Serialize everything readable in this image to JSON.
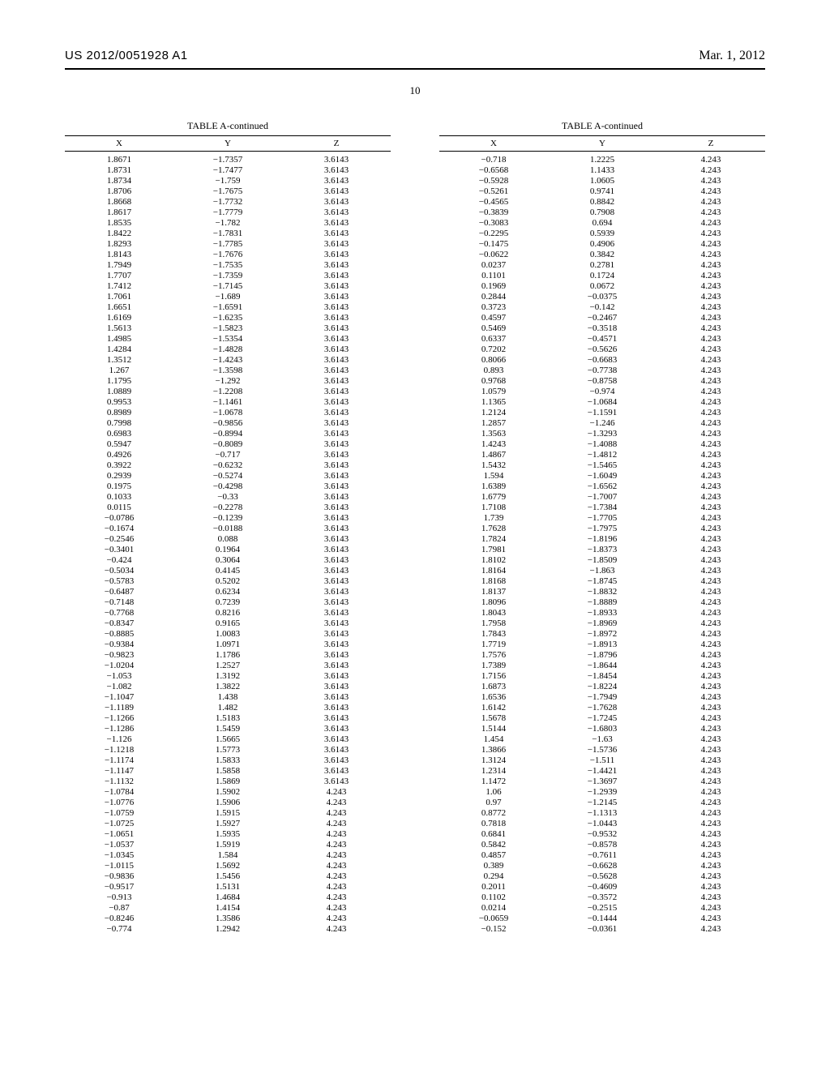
{
  "header": {
    "pub_number": "US 2012/0051928 A1",
    "date": "Mar. 1, 2012",
    "page_label": "10"
  },
  "table_title": "TABLE A-continued",
  "columns": [
    "X",
    "Y",
    "Z"
  ],
  "chart_data": {
    "type": "table",
    "left": [
      [
        "1.8671",
        "−1.7357",
        "3.6143"
      ],
      [
        "1.8731",
        "−1.7477",
        "3.6143"
      ],
      [
        "1.8734",
        "−1.759",
        "3.6143"
      ],
      [
        "1.8706",
        "−1.7675",
        "3.6143"
      ],
      [
        "1.8668",
        "−1.7732",
        "3.6143"
      ],
      [
        "1.8617",
        "−1.7779",
        "3.6143"
      ],
      [
        "1.8535",
        "−1.782",
        "3.6143"
      ],
      [
        "1.8422",
        "−1.7831",
        "3.6143"
      ],
      [
        "1.8293",
        "−1.7785",
        "3.6143"
      ],
      [
        "1.8143",
        "−1.7676",
        "3.6143"
      ],
      [
        "1.7949",
        "−1.7535",
        "3.6143"
      ],
      [
        "1.7707",
        "−1.7359",
        "3.6143"
      ],
      [
        "1.7412",
        "−1.7145",
        "3.6143"
      ],
      [
        "1.7061",
        "−1.689",
        "3.6143"
      ],
      [
        "1.6651",
        "−1.6591",
        "3.6143"
      ],
      [
        "1.6169",
        "−1.6235",
        "3.6143"
      ],
      [
        "1.5613",
        "−1.5823",
        "3.6143"
      ],
      [
        "1.4985",
        "−1.5354",
        "3.6143"
      ],
      [
        "1.4284",
        "−1.4828",
        "3.6143"
      ],
      [
        "1.3512",
        "−1.4243",
        "3.6143"
      ],
      [
        "1.267",
        "−1.3598",
        "3.6143"
      ],
      [
        "1.1795",
        "−1.292",
        "3.6143"
      ],
      [
        "1.0889",
        "−1.2208",
        "3.6143"
      ],
      [
        "0.9953",
        "−1.1461",
        "3.6143"
      ],
      [
        "0.8989",
        "−1.0678",
        "3.6143"
      ],
      [
        "0.7998",
        "−0.9856",
        "3.6143"
      ],
      [
        "0.6983",
        "−0.8994",
        "3.6143"
      ],
      [
        "0.5947",
        "−0.8089",
        "3.6143"
      ],
      [
        "0.4926",
        "−0.717",
        "3.6143"
      ],
      [
        "0.3922",
        "−0.6232",
        "3.6143"
      ],
      [
        "0.2939",
        "−0.5274",
        "3.6143"
      ],
      [
        "0.1975",
        "−0.4298",
        "3.6143"
      ],
      [
        "0.1033",
        "−0.33",
        "3.6143"
      ],
      [
        "0.0115",
        "−0.2278",
        "3.6143"
      ],
      [
        "−0.0786",
        "−0.1239",
        "3.6143"
      ],
      [
        "−0.1674",
        "−0.0188",
        "3.6143"
      ],
      [
        "−0.2546",
        "0.088",
        "3.6143"
      ],
      [
        "−0.3401",
        "0.1964",
        "3.6143"
      ],
      [
        "−0.424",
        "0.3064",
        "3.6143"
      ],
      [
        "−0.5034",
        "0.4145",
        "3.6143"
      ],
      [
        "−0.5783",
        "0.5202",
        "3.6143"
      ],
      [
        "−0.6487",
        "0.6234",
        "3.6143"
      ],
      [
        "−0.7148",
        "0.7239",
        "3.6143"
      ],
      [
        "−0.7768",
        "0.8216",
        "3.6143"
      ],
      [
        "−0.8347",
        "0.9165",
        "3.6143"
      ],
      [
        "−0.8885",
        "1.0083",
        "3.6143"
      ],
      [
        "−0.9384",
        "1.0971",
        "3.6143"
      ],
      [
        "−0.9823",
        "1.1786",
        "3.6143"
      ],
      [
        "−1.0204",
        "1.2527",
        "3.6143"
      ],
      [
        "−1.053",
        "1.3192",
        "3.6143"
      ],
      [
        "−1.082",
        "1.3822",
        "3.6143"
      ],
      [
        "−1.1047",
        "1.438",
        "3.6143"
      ],
      [
        "−1.1189",
        "1.482",
        "3.6143"
      ],
      [
        "−1.1266",
        "1.5183",
        "3.6143"
      ],
      [
        "−1.1286",
        "1.5459",
        "3.6143"
      ],
      [
        "−1.126",
        "1.5665",
        "3.6143"
      ],
      [
        "−1.1218",
        "1.5773",
        "3.6143"
      ],
      [
        "−1.1174",
        "1.5833",
        "3.6143"
      ],
      [
        "−1.1147",
        "1.5858",
        "3.6143"
      ],
      [
        "−1.1132",
        "1.5869",
        "3.6143"
      ],
      [
        "−1.0784",
        "1.5902",
        "4.243"
      ],
      [
        "−1.0776",
        "1.5906",
        "4.243"
      ],
      [
        "−1.0759",
        "1.5915",
        "4.243"
      ],
      [
        "−1.0725",
        "1.5927",
        "4.243"
      ],
      [
        "−1.0651",
        "1.5935",
        "4.243"
      ],
      [
        "−1.0537",
        "1.5919",
        "4.243"
      ],
      [
        "−1.0345",
        "1.584",
        "4.243"
      ],
      [
        "−1.0115",
        "1.5692",
        "4.243"
      ],
      [
        "−0.9836",
        "1.5456",
        "4.243"
      ],
      [
        "−0.9517",
        "1.5131",
        "4.243"
      ],
      [
        "−0.913",
        "1.4684",
        "4.243"
      ],
      [
        "−0.87",
        "1.4154",
        "4.243"
      ],
      [
        "−0.8246",
        "1.3586",
        "4.243"
      ],
      [
        "−0.774",
        "1.2942",
        "4.243"
      ]
    ],
    "right": [
      [
        "−0.718",
        "1.2225",
        "4.243"
      ],
      [
        "−0.6568",
        "1.1433",
        "4.243"
      ],
      [
        "−0.5928",
        "1.0605",
        "4.243"
      ],
      [
        "−0.5261",
        "0.9741",
        "4.243"
      ],
      [
        "−0.4565",
        "0.8842",
        "4.243"
      ],
      [
        "−0.3839",
        "0.7908",
        "4.243"
      ],
      [
        "−0.3083",
        "0.694",
        "4.243"
      ],
      [
        "−0.2295",
        "0.5939",
        "4.243"
      ],
      [
        "−0.1475",
        "0.4906",
        "4.243"
      ],
      [
        "−0.0622",
        "0.3842",
        "4.243"
      ],
      [
        "0.0237",
        "0.2781",
        "4.243"
      ],
      [
        "0.1101",
        "0.1724",
        "4.243"
      ],
      [
        "0.1969",
        "0.0672",
        "4.243"
      ],
      [
        "0.2844",
        "−0.0375",
        "4.243"
      ],
      [
        "0.3723",
        "−0.142",
        "4.243"
      ],
      [
        "0.4597",
        "−0.2467",
        "4.243"
      ],
      [
        "0.5469",
        "−0.3518",
        "4.243"
      ],
      [
        "0.6337",
        "−0.4571",
        "4.243"
      ],
      [
        "0.7202",
        "−0.5626",
        "4.243"
      ],
      [
        "0.8066",
        "−0.6683",
        "4.243"
      ],
      [
        "0.893",
        "−0.7738",
        "4.243"
      ],
      [
        "0.9768",
        "−0.8758",
        "4.243"
      ],
      [
        "1.0579",
        "−0.974",
        "4.243"
      ],
      [
        "1.1365",
        "−1.0684",
        "4.243"
      ],
      [
        "1.2124",
        "−1.1591",
        "4.243"
      ],
      [
        "1.2857",
        "−1.246",
        "4.243"
      ],
      [
        "1.3563",
        "−1.3293",
        "4.243"
      ],
      [
        "1.4243",
        "−1.4088",
        "4.243"
      ],
      [
        "1.4867",
        "−1.4812",
        "4.243"
      ],
      [
        "1.5432",
        "−1.5465",
        "4.243"
      ],
      [
        "1.594",
        "−1.6049",
        "4.243"
      ],
      [
        "1.6389",
        "−1.6562",
        "4.243"
      ],
      [
        "1.6779",
        "−1.7007",
        "4.243"
      ],
      [
        "1.7108",
        "−1.7384",
        "4.243"
      ],
      [
        "1.739",
        "−1.7705",
        "4.243"
      ],
      [
        "1.7628",
        "−1.7975",
        "4.243"
      ],
      [
        "1.7824",
        "−1.8196",
        "4.243"
      ],
      [
        "1.7981",
        "−1.8373",
        "4.243"
      ],
      [
        "1.8102",
        "−1.8509",
        "4.243"
      ],
      [
        "1.8164",
        "−1.863",
        "4.243"
      ],
      [
        "1.8168",
        "−1.8745",
        "4.243"
      ],
      [
        "1.8137",
        "−1.8832",
        "4.243"
      ],
      [
        "1.8096",
        "−1.8889",
        "4.243"
      ],
      [
        "1.8043",
        "−1.8933",
        "4.243"
      ],
      [
        "1.7958",
        "−1.8969",
        "4.243"
      ],
      [
        "1.7843",
        "−1.8972",
        "4.243"
      ],
      [
        "1.7719",
        "−1.8913",
        "4.243"
      ],
      [
        "1.7576",
        "−1.8796",
        "4.243"
      ],
      [
        "1.7389",
        "−1.8644",
        "4.243"
      ],
      [
        "1.7156",
        "−1.8454",
        "4.243"
      ],
      [
        "1.6873",
        "−1.8224",
        "4.243"
      ],
      [
        "1.6536",
        "−1.7949",
        "4.243"
      ],
      [
        "1.6142",
        "−1.7628",
        "4.243"
      ],
      [
        "1.5678",
        "−1.7245",
        "4.243"
      ],
      [
        "1.5144",
        "−1.6803",
        "4.243"
      ],
      [
        "1.454",
        "−1.63",
        "4.243"
      ],
      [
        "1.3866",
        "−1.5736",
        "4.243"
      ],
      [
        "1.3124",
        "−1.511",
        "4.243"
      ],
      [
        "1.2314",
        "−1.4421",
        "4.243"
      ],
      [
        "1.1472",
        "−1.3697",
        "4.243"
      ],
      [
        "1.06",
        "−1.2939",
        "4.243"
      ],
      [
        "0.97",
        "−1.2145",
        "4.243"
      ],
      [
        "0.8772",
        "−1.1313",
        "4.243"
      ],
      [
        "0.7818",
        "−1.0443",
        "4.243"
      ],
      [
        "0.6841",
        "−0.9532",
        "4.243"
      ],
      [
        "0.5842",
        "−0.8578",
        "4.243"
      ],
      [
        "0.4857",
        "−0.7611",
        "4.243"
      ],
      [
        "0.389",
        "−0.6628",
        "4.243"
      ],
      [
        "0.294",
        "−0.5628",
        "4.243"
      ],
      [
        "0.2011",
        "−0.4609",
        "4.243"
      ],
      [
        "0.1102",
        "−0.3572",
        "4.243"
      ],
      [
        "0.0214",
        "−0.2515",
        "4.243"
      ],
      [
        "−0.0659",
        "−0.1444",
        "4.243"
      ],
      [
        "−0.152",
        "−0.0361",
        "4.243"
      ]
    ]
  }
}
